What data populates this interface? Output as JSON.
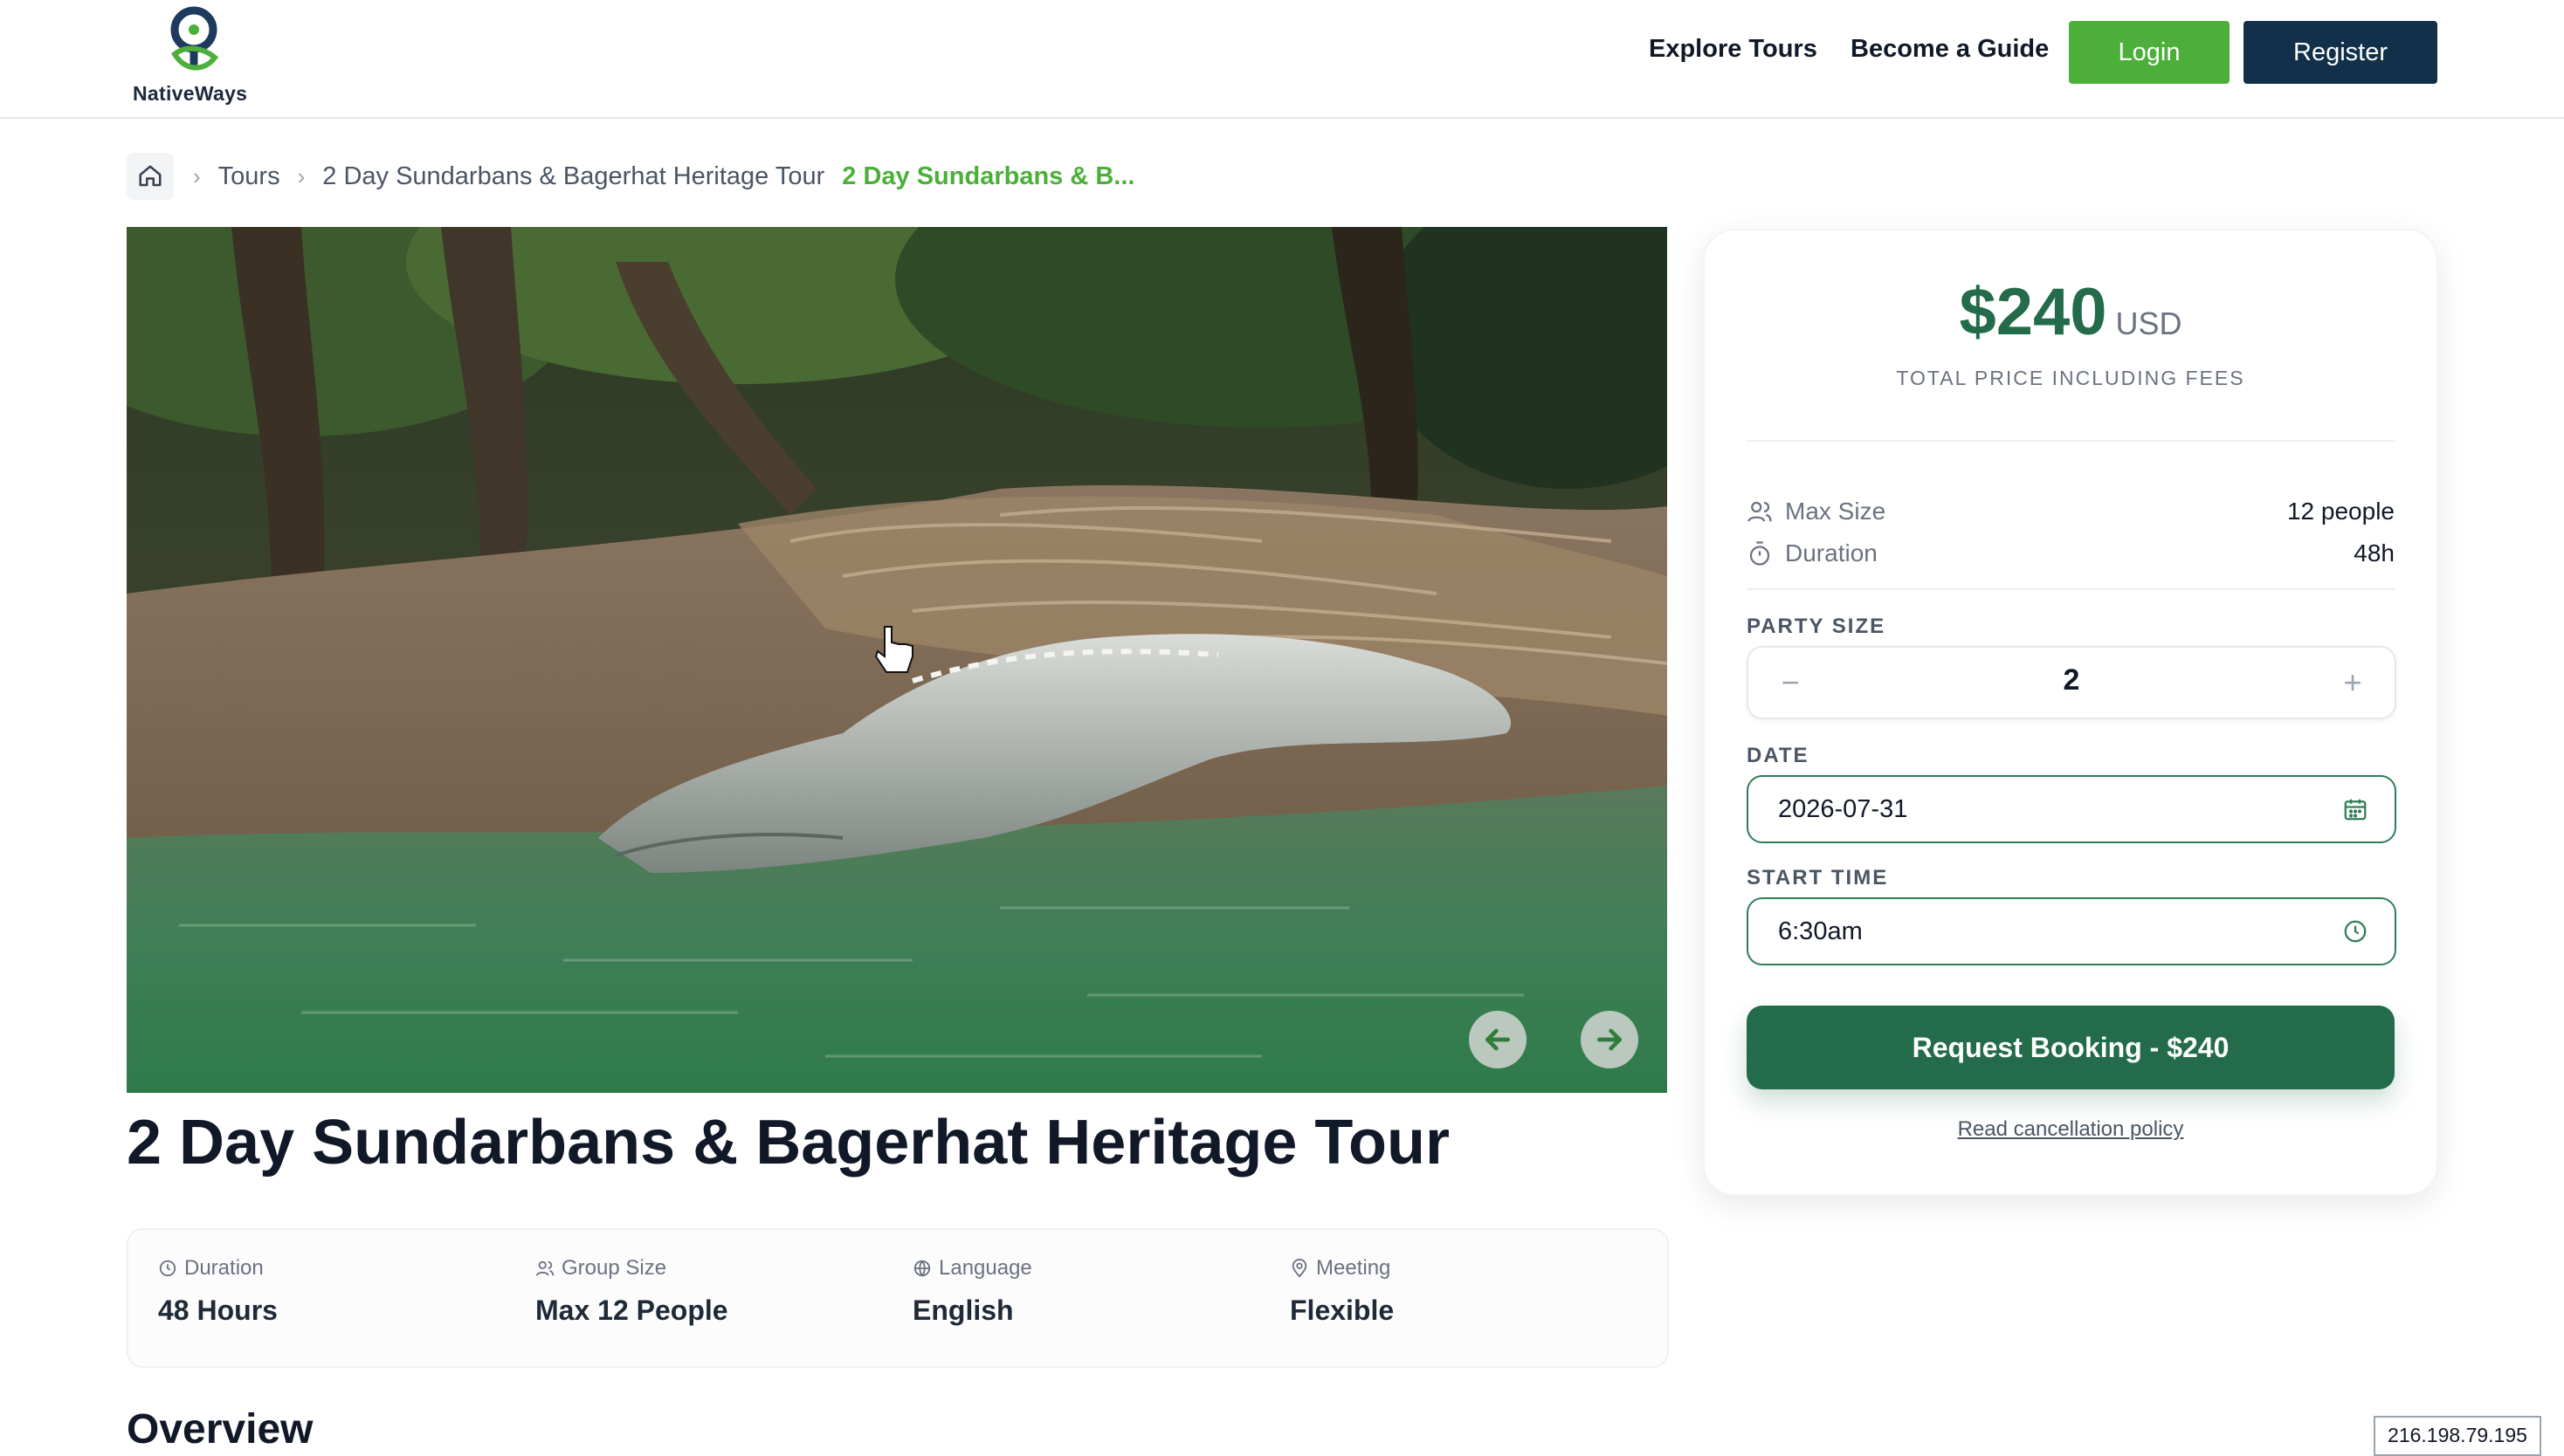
{
  "brand": {
    "name": "NativeWays"
  },
  "nav": {
    "explore": "Explore Tours",
    "become_guide": "Become a Guide",
    "login": "Login",
    "register": "Register"
  },
  "breadcrumb": {
    "tours": "Tours",
    "tour": "2 Day Sundarbans & Bagerhat Heritage Tour",
    "current": "2 Day Sundarbans & B..."
  },
  "tour": {
    "title": "2 Day Sundarbans & Bagerhat Heritage Tour",
    "facts": [
      {
        "label": "Duration",
        "value": "48 Hours",
        "icon": "clock-icon"
      },
      {
        "label": "Group Size",
        "value": "Max 12 People",
        "icon": "users-icon"
      },
      {
        "label": "Language",
        "value": "English",
        "icon": "globe-icon"
      },
      {
        "label": "Meeting",
        "value": "Flexible",
        "icon": "map-pin-icon"
      }
    ],
    "overview_heading": "Overview"
  },
  "booking": {
    "price": "$240",
    "currency": "USD",
    "price_note": "TOTAL PRICE INCLUDING FEES",
    "max_size_label": "Max Size",
    "max_size_value": "12 people",
    "duration_label": "Duration",
    "duration_value": "48h",
    "party_size_label": "PARTY SIZE",
    "party_size_value": "2",
    "date_label": "DATE",
    "date_value": "2026-07-31",
    "start_time_label": "START TIME",
    "start_time_value": "6:30am",
    "cta": "Request Booking - $240",
    "cancellation": "Read cancellation policy"
  },
  "footer_badge": {
    "ip": "216.198.79.195"
  },
  "colors": {
    "primary_green": "#236b4a",
    "accent_green": "#4caf3a",
    "navy": "#12304a"
  }
}
